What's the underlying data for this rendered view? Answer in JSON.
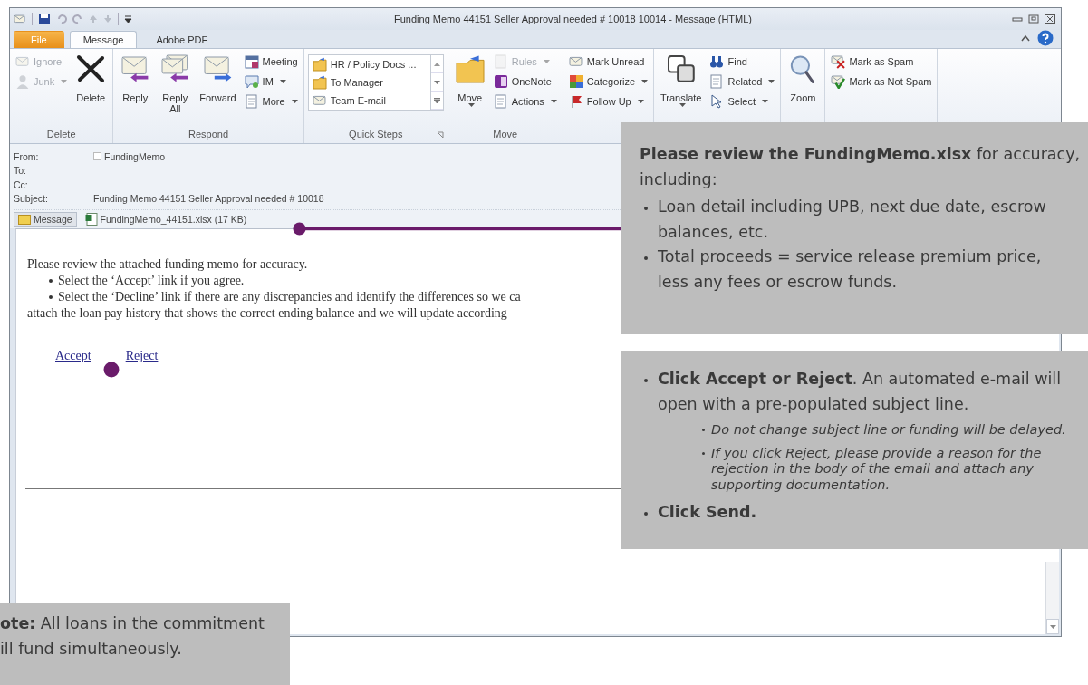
{
  "window": {
    "title": "Funding Memo 44151 Seller Approval needed # 10018 10014 - Message (HTML)"
  },
  "tabs": [
    {
      "label": "File",
      "kind": "backstage",
      "selected": false
    },
    {
      "label": "Message",
      "kind": "tab",
      "selected": true
    },
    {
      "label": "Adobe PDF",
      "kind": "tab",
      "selected": false
    }
  ],
  "ribbon": {
    "groups": [
      {
        "label": "Delete",
        "kind": "buttons",
        "launcher": false,
        "items": [
          {
            "label": "Ignore",
            "kind": "small",
            "disabled": true,
            "dropdown": false
          },
          {
            "label": "Junk",
            "kind": "small",
            "disabled": true,
            "dropdown": true
          },
          {
            "label": "Delete",
            "kind": "large",
            "disabled": false,
            "dropdown": false
          }
        ]
      },
      {
        "label": "Respond",
        "kind": "buttons",
        "launcher": false,
        "items": [
          {
            "label": "Reply",
            "kind": "large",
            "disabled": false,
            "dropdown": false
          },
          {
            "label": "Reply All",
            "kind": "large",
            "disabled": false,
            "dropdown": false
          },
          {
            "label": "Forward",
            "kind": "large",
            "disabled": false,
            "dropdown": false
          },
          {
            "label": "Meeting",
            "kind": "small",
            "disabled": false,
            "dropdown": false
          },
          {
            "label": "IM",
            "kind": "small",
            "disabled": false,
            "dropdown": true
          },
          {
            "label": "More",
            "kind": "small",
            "disabled": false,
            "dropdown": true
          }
        ]
      },
      {
        "label": "Quick Steps",
        "kind": "gallery",
        "launcher": true,
        "items": [
          {
            "label": "HR / Policy Docs ...",
            "kind": "small",
            "disabled": false,
            "dropdown": false
          },
          {
            "label": "To Manager",
            "kind": "small",
            "disabled": false,
            "dropdown": false
          },
          {
            "label": "Team E-mail",
            "kind": "small",
            "disabled": false,
            "dropdown": false
          }
        ]
      },
      {
        "label": "Move",
        "kind": "buttons",
        "launcher": false,
        "items": [
          {
            "label": "Move",
            "kind": "large",
            "disabled": false,
            "dropdown": true
          },
          {
            "label": "Rules",
            "kind": "small",
            "disabled": true,
            "dropdown": true
          },
          {
            "label": "OneNote",
            "kind": "small",
            "disabled": false,
            "dropdown": false
          },
          {
            "label": "Actions",
            "kind": "small",
            "disabled": false,
            "dropdown": true
          }
        ]
      },
      {
        "kind": "buttons",
        "launcher": false,
        "items": [
          {
            "label": "Mark Unread",
            "kind": "small",
            "disabled": false,
            "dropdown": false
          },
          {
            "label": "Categorize",
            "kind": "small",
            "disabled": false,
            "dropdown": true
          },
          {
            "label": "Follow Up",
            "kind": "small",
            "disabled": false,
            "dropdown": true
          }
        ]
      },
      {
        "kind": "buttons",
        "launcher": false,
        "items": [
          {
            "label": "Translate",
            "kind": "large",
            "disabled": false,
            "dropdown": true
          },
          {
            "label": "Find",
            "kind": "small",
            "disabled": false,
            "dropdown": false
          },
          {
            "label": "Related",
            "kind": "small",
            "disabled": false,
            "dropdown": true
          },
          {
            "label": "Select",
            "kind": "small",
            "disabled": false,
            "dropdown": true
          }
        ]
      },
      {
        "kind": "buttons",
        "launcher": false,
        "items": [
          {
            "label": "Zoom",
            "kind": "large",
            "disabled": false,
            "dropdown": false
          }
        ]
      },
      {
        "kind": "buttons",
        "launcher": false,
        "items": [
          {
            "label": "Mark as Spam",
            "kind": "small",
            "disabled": false,
            "dropdown": false
          },
          {
            "label": "Mark as Not Spam",
            "kind": "small",
            "disabled": false,
            "dropdown": false
          }
        ]
      }
    ]
  },
  "header": {
    "fields": [
      {
        "label": "From:",
        "value": "FundingMemo",
        "kind": "contact"
      },
      {
        "label": "To:",
        "kind": "plain"
      },
      {
        "label": "Cc:",
        "kind": "plain"
      },
      {
        "label": "Subject:",
        "value": "Funding Memo 44151 Seller Approval needed # 10018",
        "kind": "plain"
      }
    ],
    "attachments": [
      {
        "label": "Message",
        "kind": "message",
        "selected": true
      },
      {
        "label": "FundingMemo_44151.xlsx (17 KB)",
        "kind": "spreadsheet",
        "selected": false
      }
    ]
  },
  "body": {
    "lines": [
      {
        "text": "Please review the attached funding memo for accuracy.",
        "kind": "para"
      },
      {
        "text": "Select the ‘Accept’ link if you agree.",
        "kind": "bullet"
      },
      {
        "text": "Select the ‘Decline’ link if there are any discrepancies and identify the differences so we ca",
        "kind": "bullet"
      },
      {
        "text": "attach the loan pay history that shows the correct ending balance and we will update according",
        "kind": "para"
      }
    ],
    "links": [
      "Accept",
      "Reject"
    ]
  },
  "callouts": [
    {
      "lines": [
        {
          "text": "**Please review the FundingMemo.xlsx** for accuracy, including:",
          "kind": "para",
          "bold": false
        },
        {
          "text": "Loan detail including UPB, next due date, escrow balances, etc.",
          "kind": "bullet",
          "bold": false
        },
        {
          "text": "Total proceeds = service release premium price, less any fees or escrow funds.",
          "kind": "bullet",
          "bold": false
        }
      ]
    },
    {
      "lines": [
        {
          "text": "**Click Accept or Reject**. An automated e-mail will open with a pre-populated subject line.",
          "kind": "bullet",
          "bold": false
        },
        {
          "text": "Do not change subject line or funding will be delayed.",
          "kind": "sub",
          "bold": false
        },
        {
          "text": "If you click Reject, please provide a reason for the rejection in the body of the email and attach any supporting documentation.",
          "kind": "sub",
          "bold": false
        },
        {
          "text": "Click Send.",
          "kind": "bullet",
          "bold": true
        }
      ]
    },
    {
      "lines": [
        {
          "text": "**ote:** All loans in the commitment",
          "kind": "para",
          "bold": false
        },
        {
          "text": "ill fund simultaneously.",
          "kind": "para",
          "bold": false
        }
      ]
    }
  ]
}
